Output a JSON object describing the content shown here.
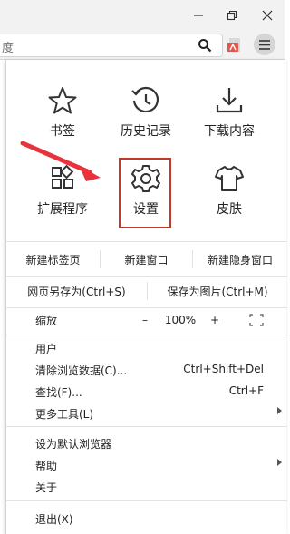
{
  "address_bar": {
    "text": "度"
  },
  "tiles": [
    {
      "label": "书签",
      "icon": "star-icon"
    },
    {
      "label": "历史记录",
      "icon": "history-icon"
    },
    {
      "label": "下载内容",
      "icon": "download-icon"
    },
    {
      "label": "扩展程序",
      "icon": "extensions-icon"
    },
    {
      "label": "设置",
      "icon": "gear-icon"
    },
    {
      "label": "皮肤",
      "icon": "tshirt-icon"
    }
  ],
  "new_row": [
    "新建标签页",
    "新建窗口",
    "新建隐身窗口"
  ],
  "save_row": [
    "网页另存为(Ctrl+S)",
    "保存为图片(Ctrl+M)"
  ],
  "zoom": {
    "label": "缩放",
    "minus": "–",
    "value": "100%",
    "plus": "+"
  },
  "items": [
    {
      "label": "用户",
      "shortcut": ""
    },
    {
      "label": "清除浏览数据(C)...",
      "shortcut": "Ctrl+Shift+Del"
    },
    {
      "label": "查找(F)...",
      "shortcut": "Ctrl+F"
    },
    {
      "label": "更多工具(L)",
      "shortcut": ""
    },
    {
      "label": "设为默认浏览器",
      "shortcut": ""
    },
    {
      "label": "帮助",
      "shortcut": ""
    },
    {
      "label": "关于",
      "shortcut": ""
    },
    {
      "label": "退出(X)",
      "shortcut": ""
    }
  ],
  "colors": {
    "highlight": "#c0392b",
    "arrow": "#e8323c"
  }
}
